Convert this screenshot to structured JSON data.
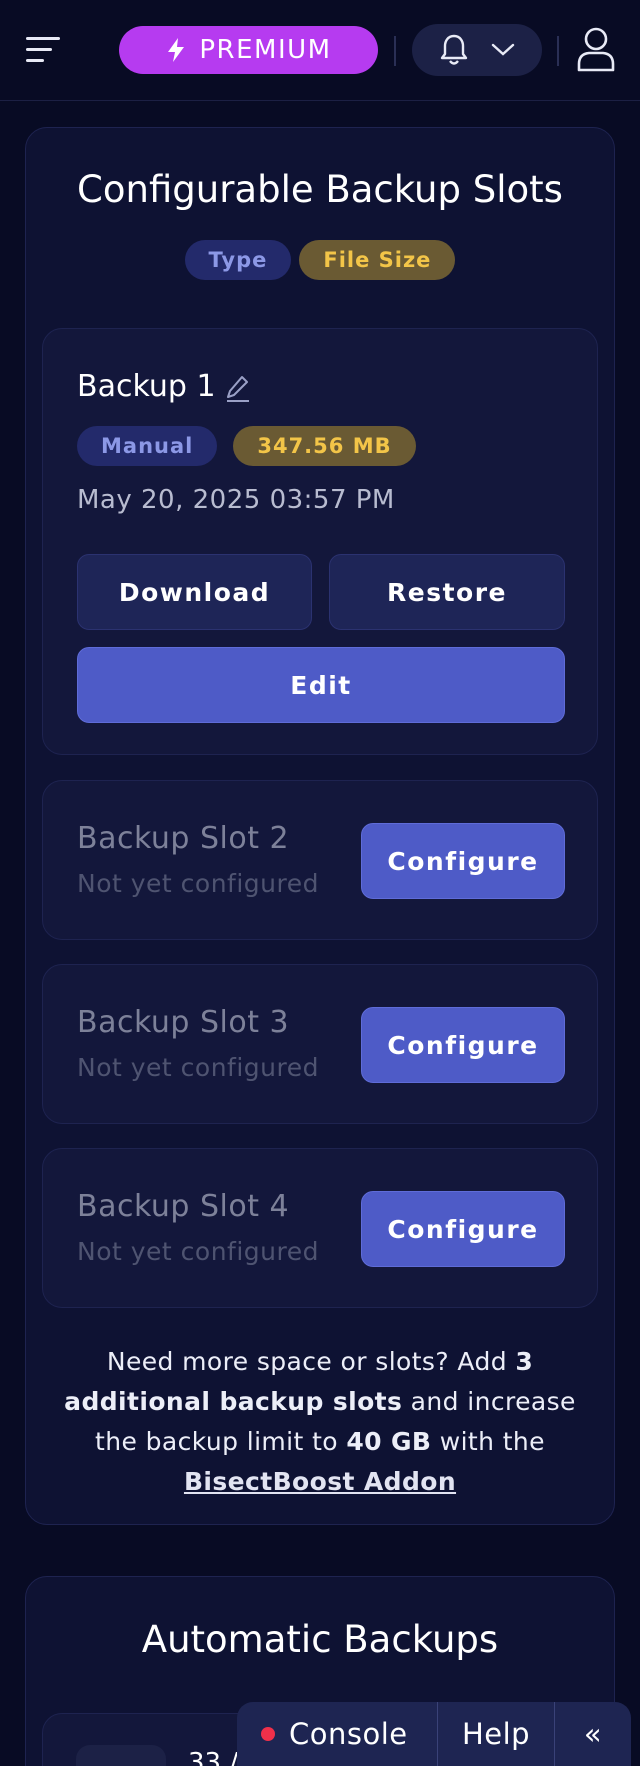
{
  "header": {
    "premium_label": "PREMIUM",
    "premium_icon": "lightning-icon",
    "notification_icon": "bell-icon",
    "dropdown_icon": "chevron-down-icon",
    "avatar_icon": "user-icon"
  },
  "backups": {
    "title": "Configurable Backup Slots",
    "legend": {
      "type_label": "Type",
      "size_label": "File Size"
    },
    "slot1": {
      "name": "Backup 1",
      "type": "Manual",
      "size": "347.56 MB",
      "date": "May 20, 2025 03:57 PM",
      "download_label": "Download",
      "restore_label": "Restore",
      "edit_label": "Edit"
    },
    "empty_slots": [
      {
        "name": "Backup Slot 2",
        "status": "Not yet configured",
        "button": "Configure"
      },
      {
        "name": "Backup Slot 3",
        "status": "Not yet configured",
        "button": "Configure"
      },
      {
        "name": "Backup Slot 4",
        "status": "Not yet configured",
        "button": "Configure"
      }
    ],
    "addon": {
      "t1": "Need more space or slots? Add ",
      "b1": "3 additional backup slots",
      "t2": " and increase the backup limit to ",
      "b2": "40 GB",
      "t3": " with the ",
      "link": "BisectBoost Addon"
    }
  },
  "automatic": {
    "title": "Automatic Backups",
    "partial_text": "33 /"
  },
  "devbar": {
    "console_label": "Console",
    "help_label": "Help",
    "collapse_label": "«"
  },
  "colors": {
    "background": "#080b24",
    "card": "#0e1233",
    "premium": "#b63bf0",
    "primary_button": "#4e5bc7",
    "type_badge": "#232a6b",
    "size_badge_text": "#f3c548",
    "console_dot": "#f0304a"
  }
}
